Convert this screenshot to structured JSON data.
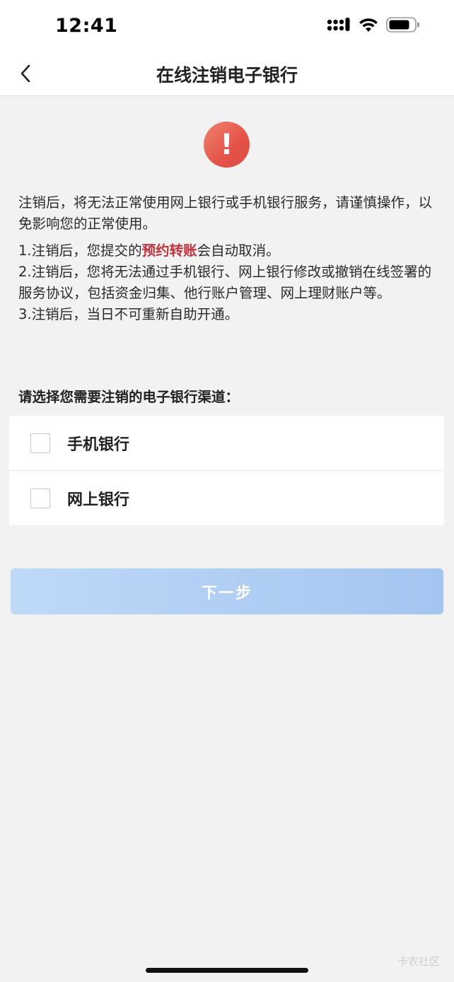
{
  "status_bar": {
    "time": "12:41"
  },
  "nav": {
    "title": "在线注销电子银行"
  },
  "notice": {
    "intro": "注销后，将无法正常使用网上银行或手机银行服务，请谨慎操作，以免影响您的正常使用。",
    "item1_before": "1.注销后，您提交的",
    "item1_highlight": "预约转账",
    "item1_after": "会自动取消。",
    "item2": "2.注销后，您将无法通过手机银行、网上银行修改或撤销在线签署的服务协议，包括资金归集、他行账户管理、网上理财账户等。",
    "item3": "3.注销后，当日不可重新自助开通。"
  },
  "channel_prompt": "请选择您需要注销的电子银行渠道：",
  "options": [
    {
      "label": "手机银行",
      "checked": false
    },
    {
      "label": "网上银行",
      "checked": false
    }
  ],
  "next_button": {
    "label": "下一步"
  },
  "watermark": "卡农社区",
  "colors": {
    "accent_highlight": "#c0343f",
    "button": "#a4c5f0",
    "warning": "#e4534a"
  },
  "icons": [
    "cellular-signal-icon",
    "wifi-icon",
    "battery-icon",
    "back-arrow-icon",
    "warning-icon"
  ]
}
